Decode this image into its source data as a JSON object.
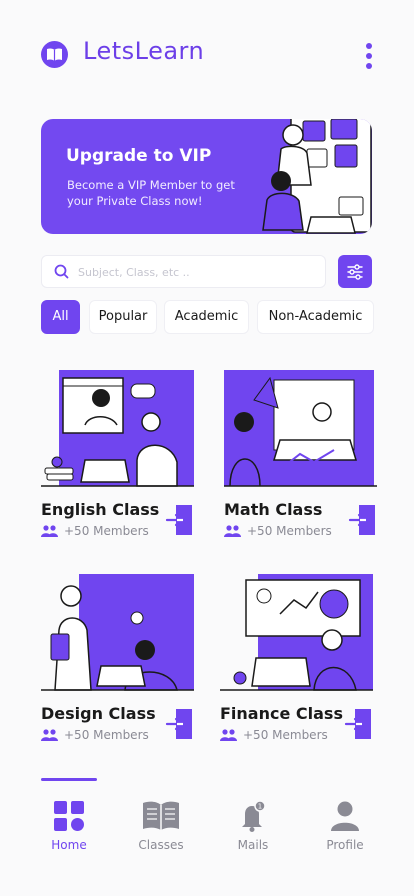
{
  "header": {
    "app_title": "LetsLearn"
  },
  "banner": {
    "title": "Upgrade to VIP",
    "text": "Become a VIP Member to get your Private Class now!"
  },
  "search": {
    "placeholder": "Subject, Class, etc ..",
    "value": ""
  },
  "chips": [
    "All",
    "Popular",
    "Academic",
    "Non-Academic"
  ],
  "chips_selected": "All",
  "classes": [
    {
      "title": "English Class",
      "members": "+50 Members"
    },
    {
      "title": "Math Class",
      "members": "+50 Members"
    },
    {
      "title": "Design Class",
      "members": "+50 Members"
    },
    {
      "title": "Finance Class",
      "members": "+50 Members"
    }
  ],
  "nav": [
    {
      "label": "Home",
      "icon": "grid-icon",
      "active": true
    },
    {
      "label": "Classes",
      "icon": "book-icon",
      "active": false
    },
    {
      "label": "Mails",
      "icon": "bell-icon",
      "active": false,
      "badge": "1"
    },
    {
      "label": "Profile",
      "icon": "user-icon",
      "active": false
    }
  ],
  "colors": {
    "accent": "#7045ef",
    "text": "#1a1a1a",
    "muted": "#8a8a94",
    "background": "#fafafb"
  }
}
